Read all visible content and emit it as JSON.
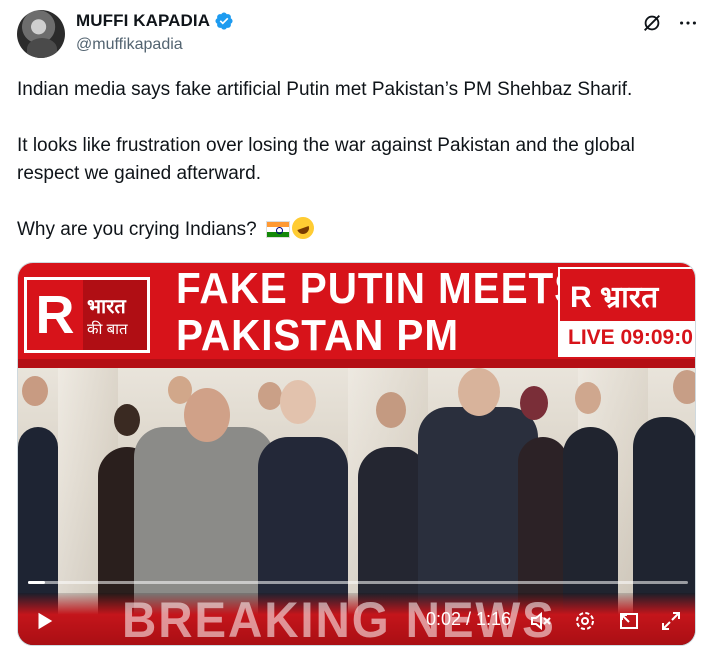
{
  "author": {
    "display_name": "MUFFI KAPADIA",
    "handle": "@muffikapadia",
    "verified": true
  },
  "tweet": {
    "line1": "Indian media says fake artificial Putin met Pakistan’s PM Shehbaz Sharif.",
    "line2": "It looks like frustration over losing the war against Pakistan and the global respect we gained afterward.",
    "line3": "Why are you crying Indians?",
    "emojis": [
      "india-flag",
      "rolling-laughing-face"
    ]
  },
  "video": {
    "headline_line1": "FAKE PUTIN MEETS",
    "headline_line2": "PAKISTAN PM",
    "channel_left_letter": "R",
    "channel_left_hindi_line1": "भारत",
    "channel_left_hindi_line2": "की बात",
    "channel_right_text": "R भ्रारत",
    "live_label": "LIVE 09:09:0",
    "bottom_text": "BREAKING NEWS",
    "current_time": "0:02",
    "duration": "1:16",
    "time_display": "0:02 / 1:16",
    "progress": 0.026,
    "accent_color": "#d7131a"
  },
  "icons": {
    "grok": "grok-icon",
    "more": "more-icon",
    "play": "play-icon",
    "mute": "mute-icon",
    "settings": "settings-icon",
    "pip": "picture-in-picture-icon",
    "fullscreen": "fullscreen-icon"
  },
  "colors": {
    "verified_blue": "#1d9bf0",
    "text": "#0f1419",
    "secondary": "#536471"
  }
}
